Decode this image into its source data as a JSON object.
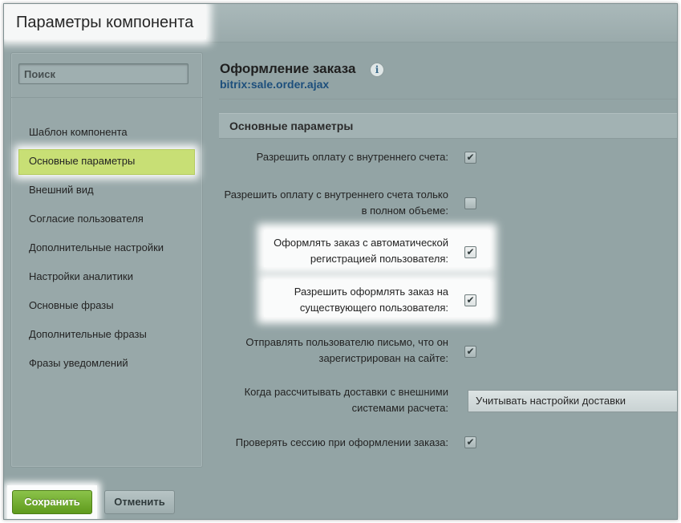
{
  "dialog": {
    "title": "Параметры компонента"
  },
  "sidebar": {
    "search_placeholder": "Поиск",
    "items": [
      {
        "label": "Шаблон компонента"
      },
      {
        "label": "Основные параметры"
      },
      {
        "label": "Внешний вид"
      },
      {
        "label": "Согласие пользователя"
      },
      {
        "label": "Дополнительные настройки"
      },
      {
        "label": "Настройки аналитики"
      },
      {
        "label": "Основные фразы"
      },
      {
        "label": "Дополнительные фразы"
      },
      {
        "label": "Фразы уведомлений"
      }
    ],
    "active_index": 1
  },
  "main": {
    "title": "Оформление заказа",
    "info_icon": "info-icon",
    "subtitle": "bitrix:sale.order.ajax",
    "section_title": "Основные параметры",
    "params": [
      {
        "line1": "Разрешить оплату с внутреннего счета:",
        "line2": "",
        "checked": true
      },
      {
        "line1": "Разрешить оплату с внутреннего счета только",
        "line2": "в полном объеме:",
        "checked": false
      },
      {
        "line1": "Оформлять заказ с автоматической",
        "line2": "регистрацией пользователя:",
        "checked": true
      },
      {
        "line1": "Разрешить оформлять заказ на",
        "line2": "существующего пользователя:",
        "checked": true
      },
      {
        "line1": "Отправлять пользователю письмо, что он",
        "line2": "зарегистрирован на сайте:",
        "checked": true
      },
      {
        "line1": "Когда рассчитывать доставки с внешними",
        "line2": "системами расчета:",
        "select_value": "Учитывать настройки доставки"
      },
      {
        "line1": "Проверять сессию при оформлении заказа:",
        "line2": "",
        "checked": true
      }
    ]
  },
  "footer": {
    "save_label": "Сохранить",
    "cancel_label": "Отменить"
  },
  "colors": {
    "accent_green": "#7ab532",
    "active_item_bg": "#c8df75",
    "subtitle_blue": "#1d4f7c",
    "dialog_bg": "#93a4a5"
  },
  "check_glyph": "✔"
}
